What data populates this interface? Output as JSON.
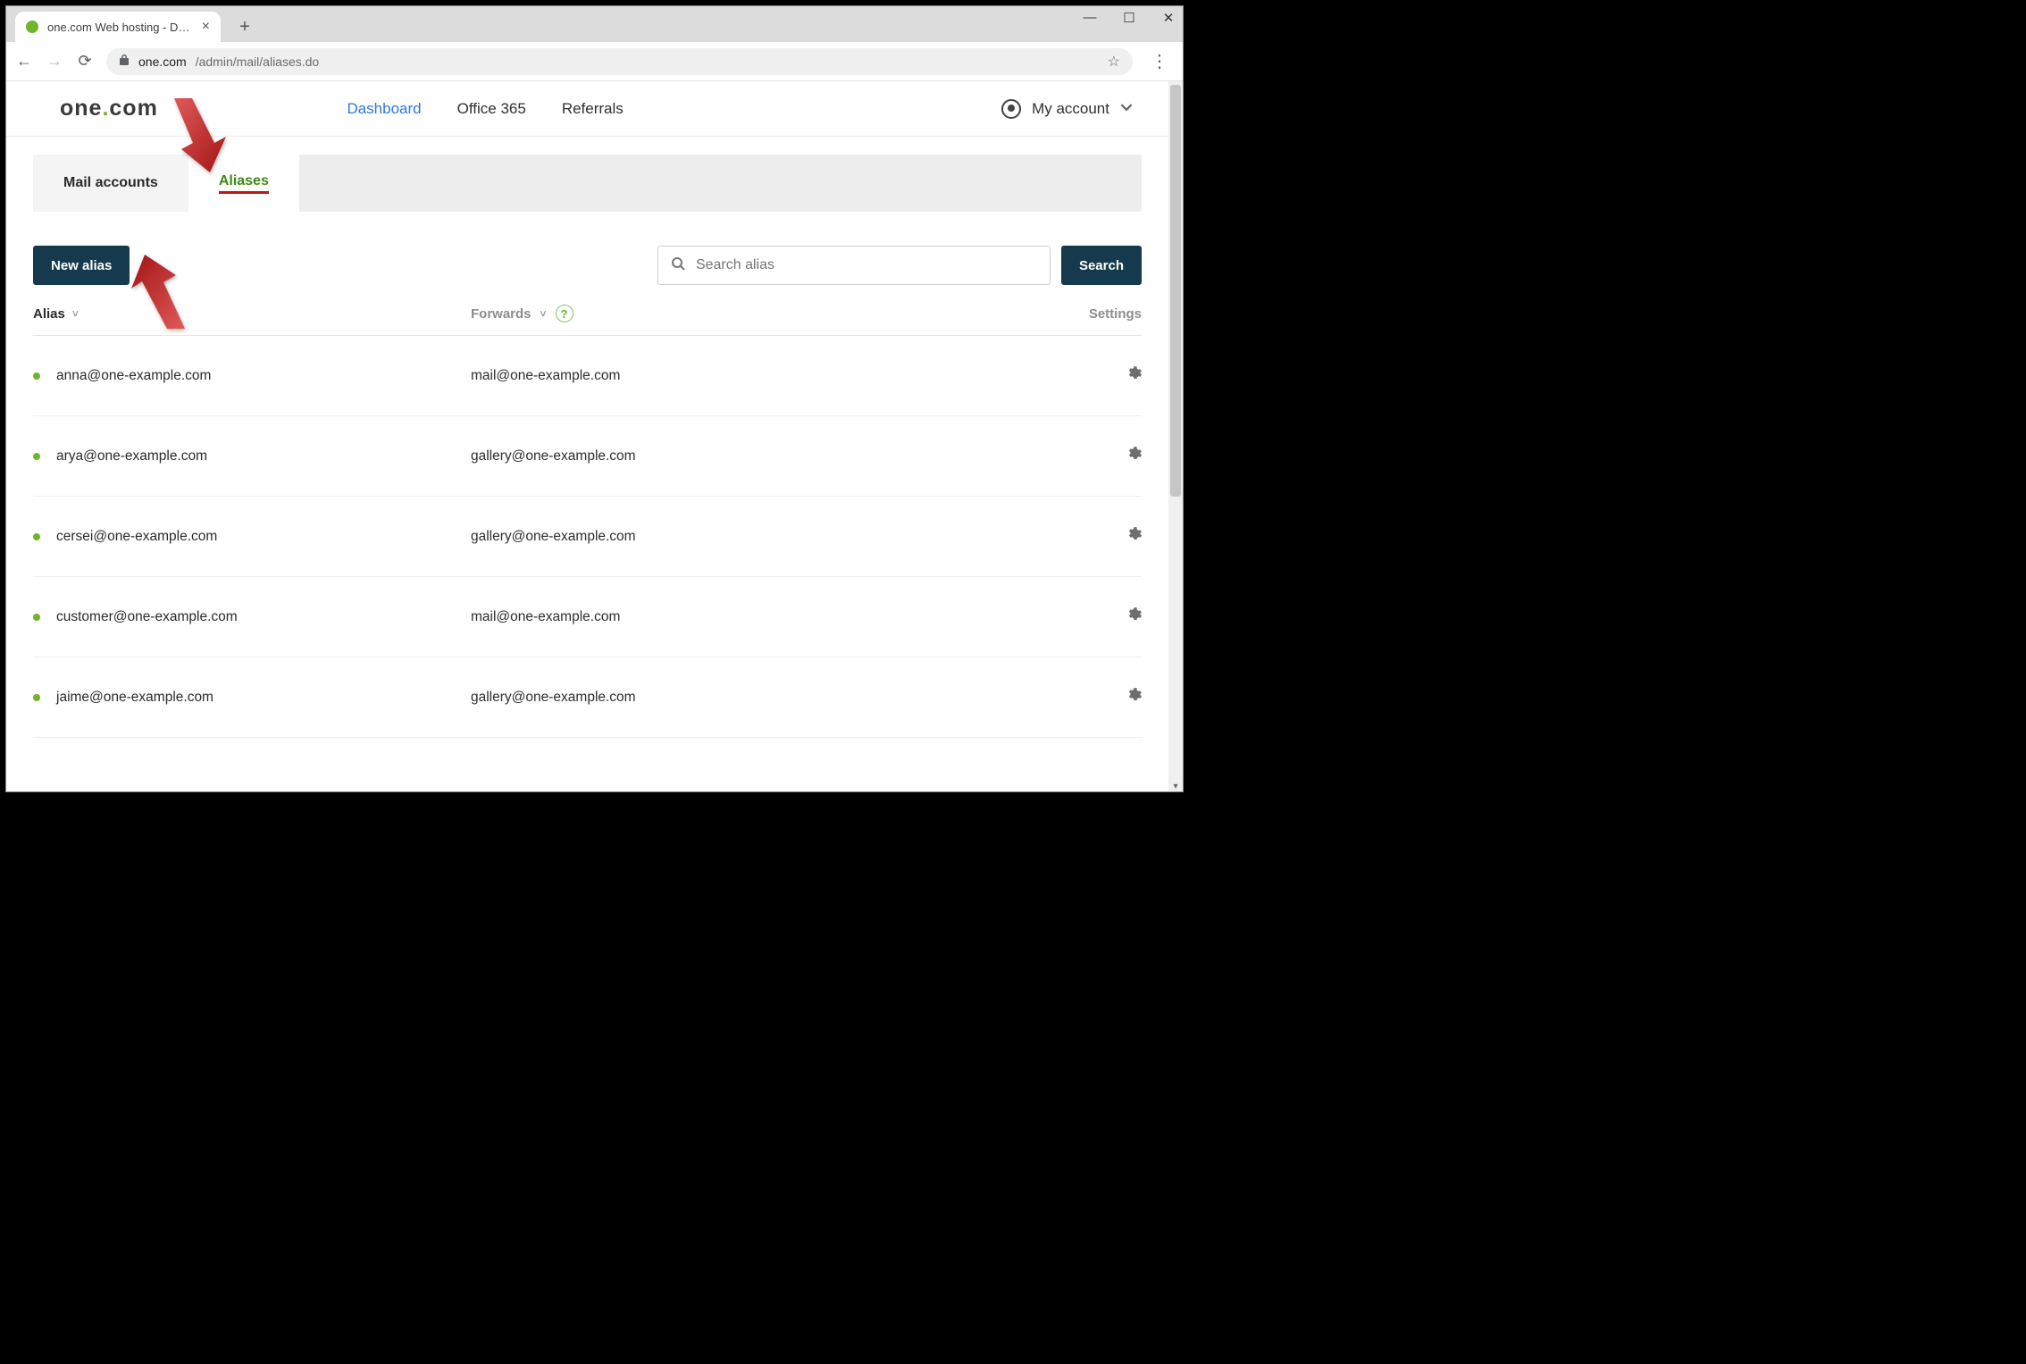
{
  "browser": {
    "tab_title": "one.com Web hosting  -  Domain",
    "url_host": "one.com",
    "url_path": "/admin/mail/aliases.do"
  },
  "header": {
    "logo_left": "one",
    "logo_right": "com",
    "nav": {
      "dashboard": "Dashboard",
      "office365": "Office 365",
      "referrals": "Referrals"
    },
    "account_label": "My account"
  },
  "tabs": {
    "mail_accounts": "Mail accounts",
    "aliases": "Aliases"
  },
  "actions": {
    "new_alias": "New alias",
    "search_placeholder": "Search alias",
    "search_button": "Search"
  },
  "table": {
    "head_alias": "Alias",
    "head_forwards": "Forwards",
    "head_settings": "Settings",
    "rows": [
      {
        "alias": "anna@one-example.com",
        "forwards": "mail@one-example.com"
      },
      {
        "alias": "arya@one-example.com",
        "forwards": "gallery@one-example.com"
      },
      {
        "alias": "cersei@one-example.com",
        "forwards": "gallery@one-example.com"
      },
      {
        "alias": "customer@one-example.com",
        "forwards": "mail@one-example.com"
      },
      {
        "alias": "jaime@one-example.com",
        "forwards": "gallery@one-example.com"
      }
    ]
  }
}
